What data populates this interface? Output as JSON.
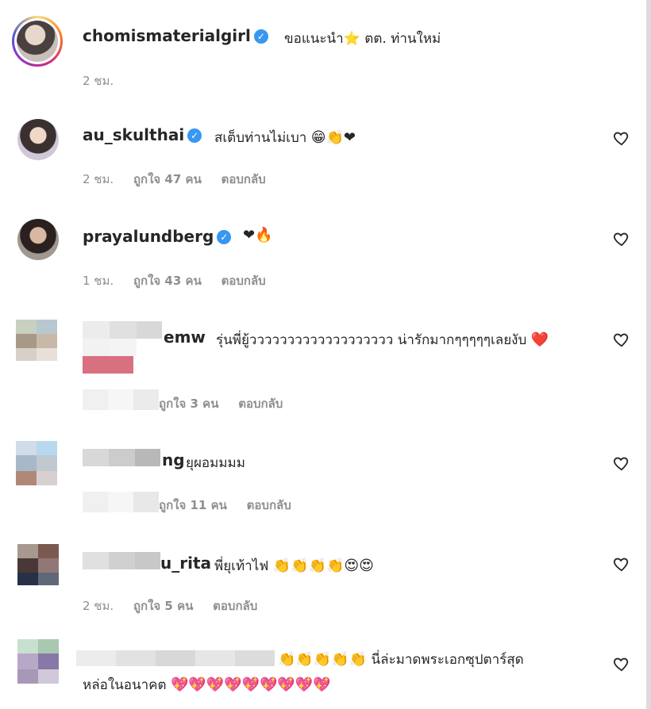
{
  "post": {
    "username": "chomismaterialgirl",
    "caption": "ขอแนะนำ⭐ ตต. ท่านใหม่",
    "time": "2 ชม."
  },
  "comments": [
    {
      "username": "au_skulthai",
      "verified": true,
      "text": "สเต็บท่านไม่เบา",
      "emojis": "😁👏❤",
      "time": "2 ชม.",
      "likes": "ถูกใจ 47 คน",
      "reply": "ตอบกลับ"
    },
    {
      "username": "prayalundberg",
      "verified": true,
      "text": "",
      "emojis": "❤🔥",
      "time": "1 ชม.",
      "likes": "ถูกใจ 43 คน",
      "reply": "ตอบกลับ"
    },
    {
      "username": "emw",
      "text": "รุ่นพี่ยู้ววววววววววววววววววว น่ารักมากๆๆๆๆๆเลยงับ",
      "emojis": "❤️",
      "time": "",
      "likes": "ถูกใจ 3 คน",
      "reply": "ตอบกลับ"
    },
    {
      "username": "ng",
      "text": "ยุผอมมมม",
      "emojis": "",
      "time": "",
      "likes": "ถูกใจ 11 คน",
      "reply": "ตอบกลับ"
    },
    {
      "username": "u_rita",
      "text": "พี่ยุเท้าไฟ",
      "emojis": "👏👏👏👏😍😍",
      "time": "2 ชม.",
      "likes": "ถูกใจ 5 คน",
      "reply": "ตอบกลับ"
    },
    {
      "username": "",
      "text_line1": "นี่ล่ะมาดพระเอกซุปตาร์สุด",
      "emojis_line1": "👏👏👏👏👏",
      "text_line2": "หล่อในอนาคต",
      "emojis_line2": "💖💖💖💖💖💖💖💖💖"
    }
  ],
  "colors": {
    "verified": "#3897f0",
    "meta": "#8e8e8e",
    "text": "#262626"
  },
  "icons": {
    "like": "heart-outline-icon",
    "verified": "verified-badge-icon"
  }
}
